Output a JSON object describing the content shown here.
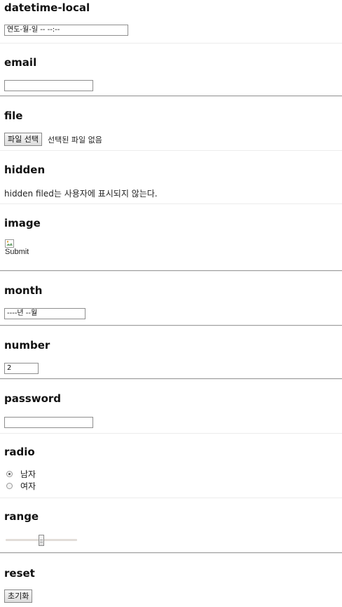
{
  "sections": {
    "datetime_local": {
      "heading": "datetime-local",
      "value": "연도-월-일 -- --:--"
    },
    "email": {
      "heading": "email",
      "value": ""
    },
    "file": {
      "heading": "file",
      "button_label": "파일 선택",
      "status": "선택된 파일 없음"
    },
    "hidden": {
      "heading": "hidden",
      "note": "hidden filed는 사용자에 표시되지 않는다."
    },
    "image": {
      "heading": "image",
      "alt_text": "Submit",
      "icon": "broken-image-icon"
    },
    "month": {
      "heading": "month",
      "value": "----년 --월"
    },
    "number": {
      "heading": "number",
      "value": "2"
    },
    "password": {
      "heading": "password",
      "value": ""
    },
    "radio": {
      "heading": "radio",
      "options": [
        {
          "label": "남자",
          "checked": true
        },
        {
          "label": "여자",
          "checked": false
        }
      ]
    },
    "range": {
      "heading": "range",
      "value_fraction": 0.5
    },
    "reset": {
      "heading": "reset",
      "button_label": "초기화"
    }
  }
}
